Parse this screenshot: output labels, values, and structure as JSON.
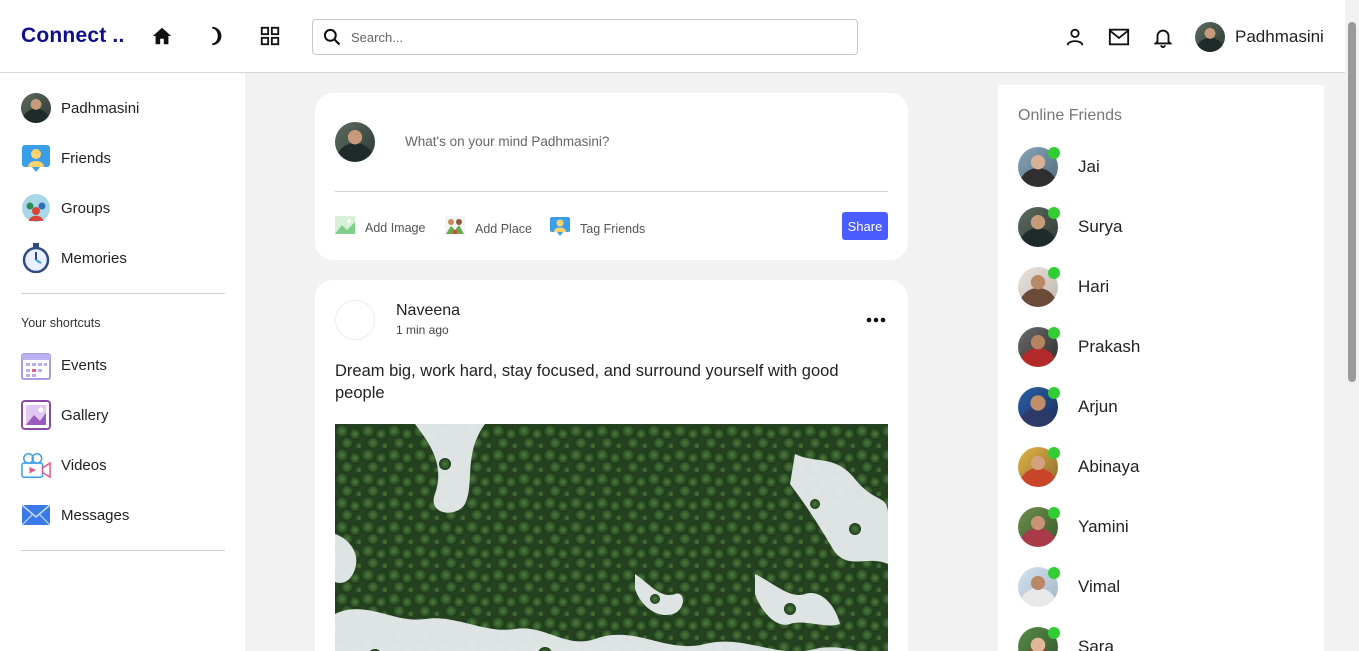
{
  "navbar": {
    "logo": "Connect ..",
    "search_placeholder": "Search...",
    "user_name": "Padhmasini",
    "icons": [
      "home-icon",
      "moon-icon",
      "grid-icon",
      "user-icon",
      "mail-icon",
      "bell-icon"
    ]
  },
  "left_sidebar": {
    "items": [
      {
        "label": "Padhmasini",
        "icon": "avatar"
      },
      {
        "label": "Friends",
        "icon": "friends-icon"
      },
      {
        "label": "Groups",
        "icon": "groups-icon"
      },
      {
        "label": "Memories",
        "icon": "stopwatch-icon"
      }
    ],
    "shortcuts_title": "Your shortcuts",
    "shortcuts": [
      {
        "label": "Events",
        "icon": "calendar-icon"
      },
      {
        "label": "Gallery",
        "icon": "gallery-icon"
      },
      {
        "label": "Videos",
        "icon": "video-icon"
      },
      {
        "label": "Messages",
        "icon": "envelope-icon"
      }
    ]
  },
  "composer": {
    "placeholder": "What's on your mind Padhmasini?",
    "actions": [
      {
        "label": "Add Image",
        "icon": "image-icon"
      },
      {
        "label": "Add Place",
        "icon": "place-icon"
      },
      {
        "label": "Tag Friends",
        "icon": "tag-friends-icon"
      }
    ],
    "share_label": "Share"
  },
  "post": {
    "author": "Naveena",
    "time": "1 min ago",
    "text": "Dream big, work hard, stay focused, and surround yourself with good people",
    "image": "aerial-snowy-forest"
  },
  "right_sidebar": {
    "title": "Online Friends",
    "friends": [
      {
        "name": "Jai"
      },
      {
        "name": "Surya"
      },
      {
        "name": "Hari"
      },
      {
        "name": "Prakash"
      },
      {
        "name": "Arjun"
      },
      {
        "name": "Abinaya"
      },
      {
        "name": "Yamini"
      },
      {
        "name": "Vimal"
      },
      {
        "name": "Sara"
      }
    ],
    "online_color": "#32cd32"
  },
  "colors": {
    "logo": "#0f0f8c",
    "share_button": "#4b5dff",
    "background": "#f2f2f2"
  }
}
